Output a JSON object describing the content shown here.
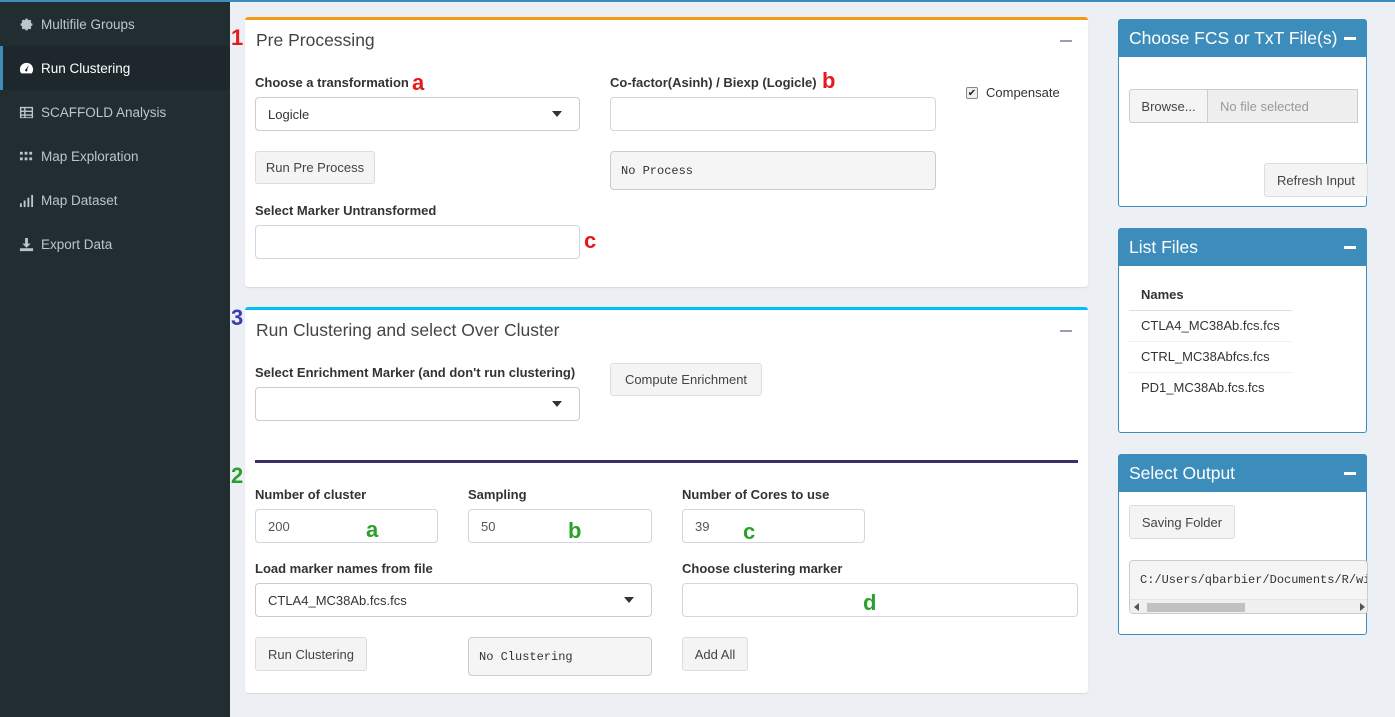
{
  "sidebar": {
    "items": [
      {
        "label": "Multifile Groups",
        "icon": "gear-icon"
      },
      {
        "label": "Run Clustering",
        "icon": "dashboard-icon"
      },
      {
        "label": "SCAFFOLD Analysis",
        "icon": "table-icon"
      },
      {
        "label": "Map Exploration",
        "icon": "dots-grid-icon"
      },
      {
        "label": "Map Dataset",
        "icon": "signal-bars-icon"
      },
      {
        "label": "Export Data",
        "icon": "download-icon"
      }
    ]
  },
  "preprocess": {
    "title": "Pre Processing",
    "transform_label": "Choose a transformation",
    "transform_value": "Logicle",
    "cofactor_label": "Co-factor(Asinh) / Biexp (Logicle)",
    "cofactor_value": "",
    "compensate_label": "Compensate",
    "compensate_checked": "✔",
    "run_button": "Run Pre Process",
    "status": "No Process",
    "untransformed_label": "Select Marker Untransformed",
    "untransformed_value": ""
  },
  "clustering": {
    "title": "Run Clustering and select Over Cluster",
    "enrichment_label": "Select Enrichment Marker (and don't run clustering)",
    "enrichment_value": "",
    "compute_button": "Compute Enrichment",
    "num_cluster_label": "Number of cluster",
    "num_cluster_value": "200",
    "sampling_label": "Sampling",
    "sampling_value": "50",
    "cores_label": "Number of Cores to use",
    "cores_value": "39",
    "load_marker_label": "Load marker names from file",
    "load_marker_value": "CTLA4_MC38Ab.fcs.fcs",
    "choose_marker_label": "Choose clustering marker",
    "choose_marker_value": "",
    "run_button": "Run Clustering",
    "status": "No Clustering",
    "add_all_button": "Add All"
  },
  "annotations": {
    "n1": "1",
    "n2": "2",
    "n3": "3",
    "a": "a",
    "b": "b",
    "c": "c",
    "d": "d"
  },
  "files_box": {
    "title": "Choose FCS or TxT File(s)",
    "browse": "Browse...",
    "placeholder": "No file selected",
    "refresh": "Refresh Input"
  },
  "list_files": {
    "title": "List Files",
    "header": "Names",
    "rows": [
      "CTLA4_MC38Ab.fcs.fcs",
      "CTRL_MC38Abfcs.fcs",
      "PD1_MC38Ab.fcs.fcs"
    ]
  },
  "output_box": {
    "title": "Select Output",
    "button": "Saving Folder",
    "path": "C:/Users/qbarbier/Documents/R/wi"
  },
  "colors": {
    "sidebar_bg": "#222d32",
    "primary": "#3c8dbc",
    "warning": "#f39c12",
    "info": "#00c0ef",
    "annotation_red": "#e41a1c",
    "annotation_green": "#2ca02c",
    "annotation_blue": "#3a3ab5"
  }
}
